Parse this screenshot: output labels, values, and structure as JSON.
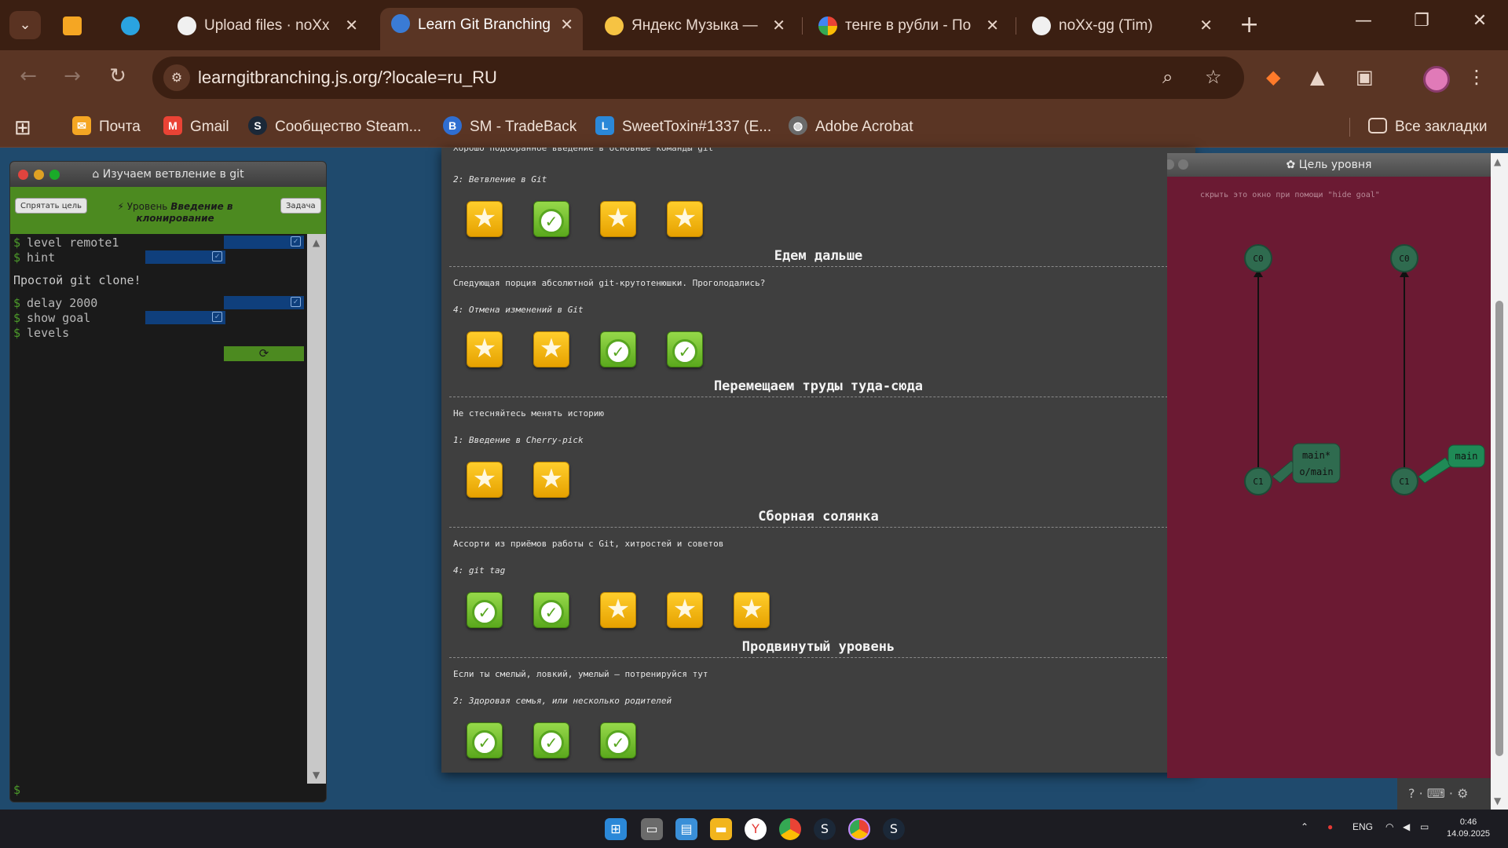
{
  "browser": {
    "tabs": [
      {
        "label": "",
        "icon": "mail-icon",
        "active": false
      },
      {
        "label": "",
        "icon": "telegram-icon",
        "active": false
      },
      {
        "label": "Upload files · noXx",
        "icon": "github-icon",
        "active": false
      },
      {
        "label": "Learn Git Branching",
        "icon": "learngit-icon",
        "active": true
      },
      {
        "label": "Яндекс Музыка —",
        "icon": "yandex-music-icon",
        "active": false
      },
      {
        "label": "тенге в рубли - По",
        "icon": "google-icon",
        "active": false
      },
      {
        "label": "noXx-gg (Tim)",
        "icon": "github-icon",
        "active": false
      }
    ],
    "url": "learngitbranching.js.org/?locale=ru_RU",
    "bookmarks": [
      {
        "label": "Почта",
        "icon": "mail-icon",
        "color": "#f5a623"
      },
      {
        "label": "Gmail",
        "icon": "gmail-icon",
        "color": "#ea4335"
      },
      {
        "label": "Сообщество Steam...",
        "icon": "steam-icon",
        "color": "#1b2838"
      },
      {
        "label": "SM - TradeBack",
        "icon": "tradeback-icon",
        "color": "#2f6ed1"
      },
      {
        "label": "SweetToxin#1337 (E...",
        "icon": "letter-l-icon",
        "color": "#2b88d8"
      },
      {
        "label": "Adobe Acrobat",
        "icon": "globe-icon",
        "color": "#6b6b6b"
      }
    ],
    "all_bookmarks": "Все закладки"
  },
  "terminal": {
    "title": "Изучаем ветвление в git",
    "hide_goal": "Спрятать цель",
    "task": "Задача",
    "level_prefix": "Уровень",
    "level_name": "Введение в клонирование",
    "lines": [
      {
        "prompt": "$",
        "text": "level remote1"
      },
      {
        "prompt": "$",
        "text": "hint"
      },
      {
        "prompt": "",
        "text": "Простой git clone!"
      },
      {
        "prompt": "$",
        "text": "delay 2000"
      },
      {
        "prompt": "$",
        "text": "show goal"
      },
      {
        "prompt": "$",
        "text": "levels"
      }
    ],
    "input_prompt": "$"
  },
  "levels": {
    "cut_top_text": "Хорошо подобранное введение в основные команды git",
    "sections": [
      {
        "heading": "",
        "desc": "",
        "link": "2: Ветвление в Git",
        "icons": [
          "star",
          "check",
          "star",
          "star"
        ]
      },
      {
        "heading": "Едем дальше",
        "desc": "Следующая порция абсолютной git-крутотенюшки. Проголодались?",
        "link": "4: Отмена изменений в Git",
        "icons": [
          "star",
          "star",
          "check",
          "check"
        ]
      },
      {
        "heading": "Перемещаем труды туда-сюда",
        "desc": "Не стесняйтесь менять историю",
        "link": "1: Введение в Cherry-pick",
        "icons": [
          "star",
          "star"
        ]
      },
      {
        "heading": "Сборная солянка",
        "desc": "Ассорти из приёмов работы с Git, хитростей и советов",
        "link": "4: git tag",
        "icons": [
          "check",
          "check",
          "star",
          "star",
          "star"
        ]
      },
      {
        "heading": "Продвинутый уровень",
        "desc": "Если ты смелый, ловкий, умелый – потренируйся тут",
        "link": "2: Здоровая семья, или несколько родителей",
        "icons": [
          "check",
          "check",
          "check"
        ]
      }
    ]
  },
  "goal": {
    "title": "Цель уровня",
    "hint": "скрыть это окно при помощи \"hide goal\"",
    "left_tree": {
      "c0": "C0",
      "c1": "C1",
      "branch_line1": "main*",
      "branch_line2": "o/main"
    },
    "right_tree": {
      "c0": "C0",
      "c1": "C1",
      "branch": "main"
    },
    "footer": "? · ⌨ · ⚙"
  },
  "taskbar": {
    "lang": "ENG",
    "time": "0:46",
    "date": "14.09.2025"
  },
  "colors": {
    "tab_bg": "#3b1f12",
    "toolbar_bg": "#5a3524",
    "page_bg": "#1f4a6d",
    "goal_bg": "#6b1a33",
    "term_green": "#4c8a20",
    "star_gold": "#ffce2c",
    "check_green": "#5aa81c",
    "commit_fill": "#2f6b4f"
  }
}
